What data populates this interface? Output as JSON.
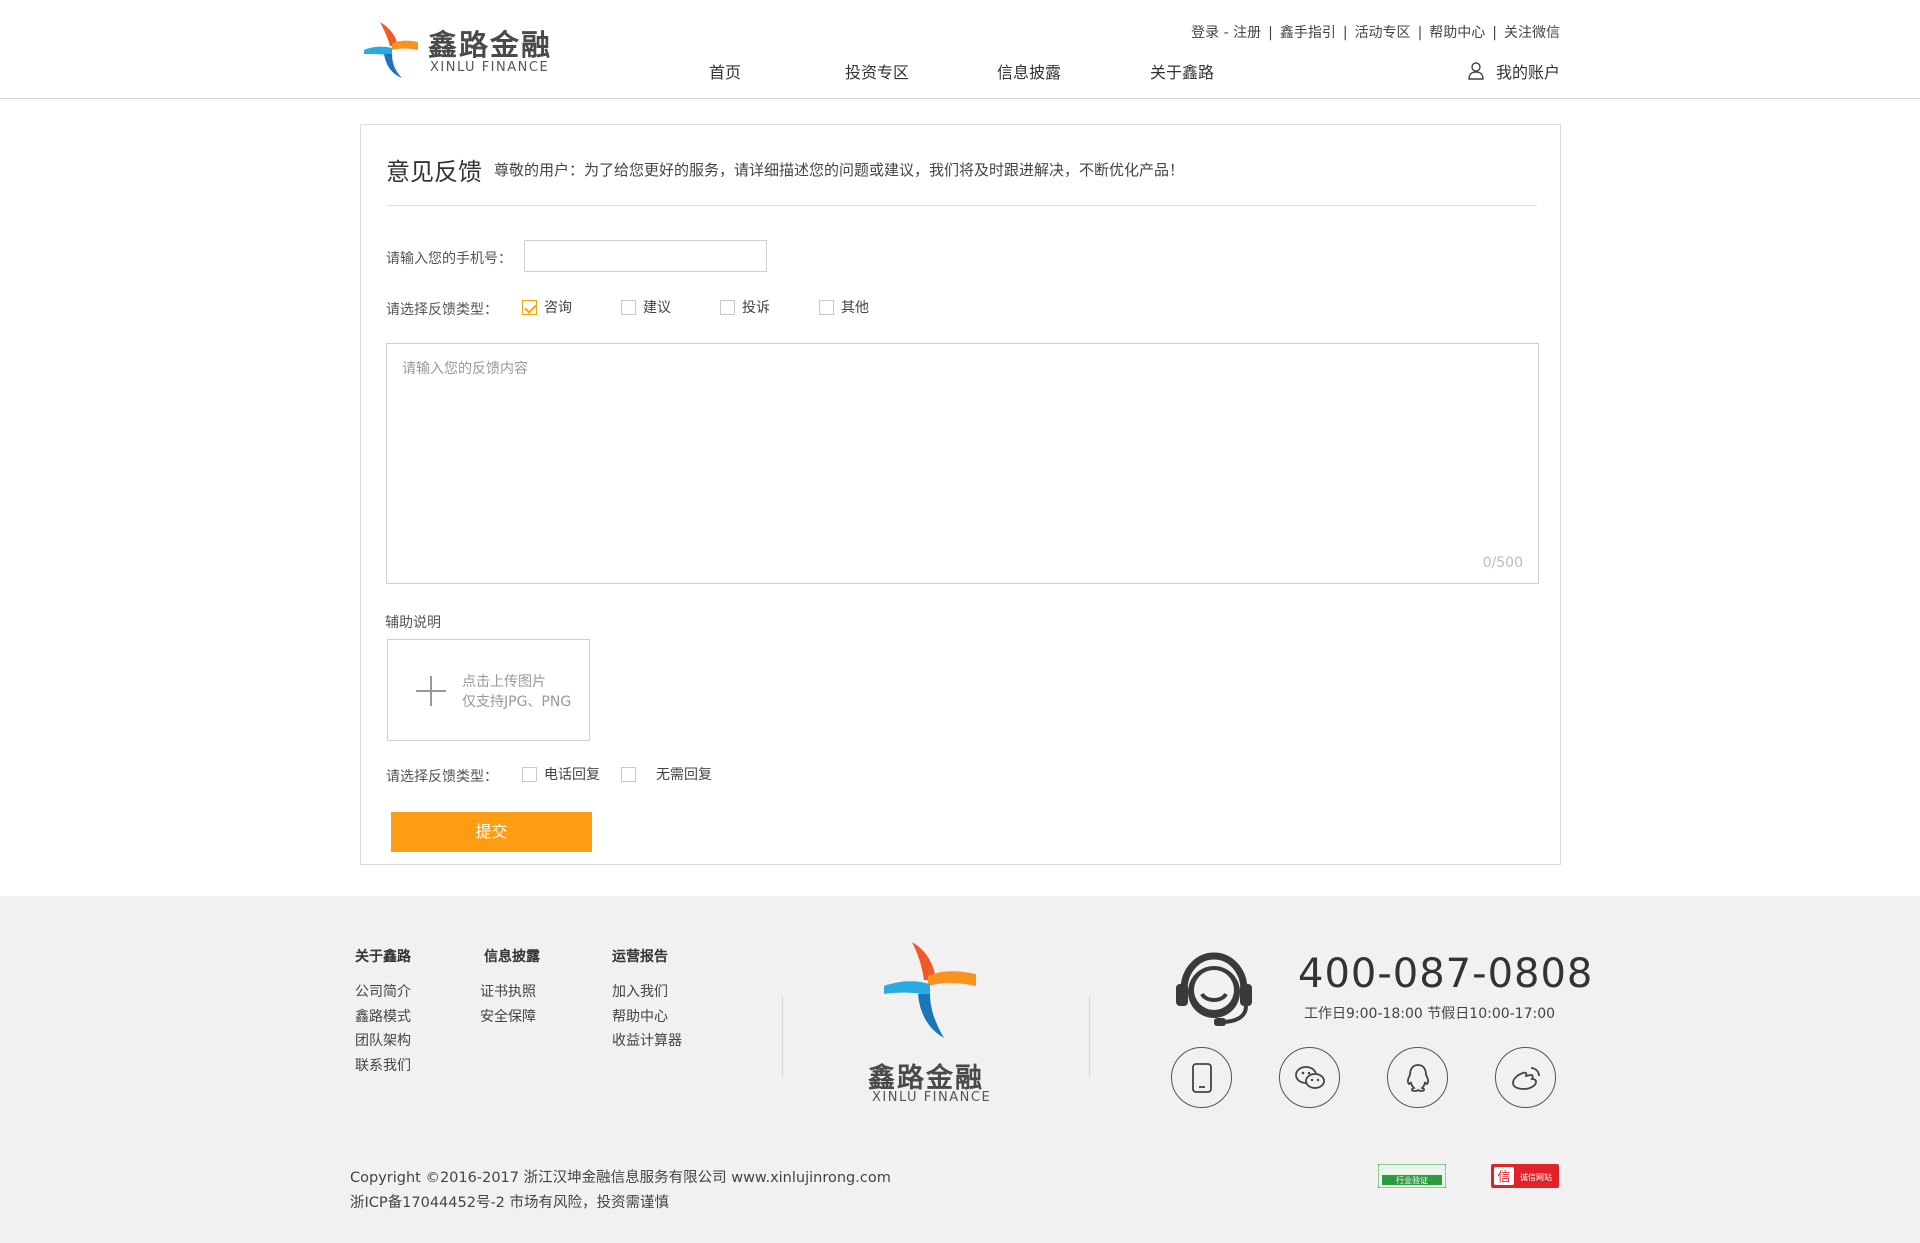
{
  "header": {
    "logo_cn": "鑫路金融",
    "logo_en": "XINLU FINANCE",
    "top_links": [
      "登录 - 注册",
      "鑫手指引",
      "活动专区",
      "帮助中心",
      "关注微信"
    ],
    "nav": [
      "首页",
      "投资专区",
      "信息披露",
      "关于鑫路"
    ],
    "account_label": "我的账户"
  },
  "feedback": {
    "title": "意见反馈",
    "note": "尊敬的用户：为了给您更好的服务，请详细描述您的问题或建议，我们将及时跟进解决，不断优化产品！",
    "phone_label": "请输入您的手机号：",
    "phone_value": "",
    "type_label": "请选择反馈类型：",
    "types": [
      {
        "label": "咨询",
        "checked": true
      },
      {
        "label": "建议",
        "checked": false
      },
      {
        "label": "投诉",
        "checked": false
      },
      {
        "label": "其他",
        "checked": false
      }
    ],
    "content_placeholder": "请输入您的反馈内容",
    "char_count": "0/500",
    "aux_label": "辅助说明",
    "upload_line1": "点击上传图片",
    "upload_line2": "仅支持JPG、PNG",
    "reply_label": "请选择反馈类型：",
    "reply_types": [
      {
        "label": "电话回复",
        "checked": false
      },
      {
        "label": "无需回复",
        "checked": false
      }
    ],
    "submit_label": "提交"
  },
  "footer": {
    "col1": {
      "title": "关于鑫路",
      "items": [
        "公司简介",
        "鑫路模式",
        "团队架构",
        "联系我们"
      ]
    },
    "col2": {
      "title": "信息披露",
      "items": [
        "证书执照",
        "安全保障"
      ]
    },
    "col3": {
      "title": "运营报告",
      "items": [
        "加入我们",
        "帮助中心",
        "收益计算器"
      ]
    },
    "logo_cn": "鑫路金融",
    "logo_en": "XINLU FINANCE",
    "phone": "400-087-0808",
    "hours": "工作日9:00-18:00  节假日10:00-17:00",
    "social_icons": [
      "mobile-icon",
      "wechat-icon",
      "qq-icon",
      "weibo-icon"
    ],
    "copyright": "Copyright ©2016-2017 浙江汉坤金融信息服务有限公司 www.xinlujinrong.com",
    "icp": "浙ICP备17044452号-2 市场有风险，投资需谨慎",
    "badge1": "行业验证",
    "badge2": "诚信网站"
  },
  "colors": {
    "accent": "#ff9d12",
    "logo_blue": "#1aa3e8",
    "logo_orange": "#f7931e",
    "footer_bg": "#f1f1f1"
  }
}
